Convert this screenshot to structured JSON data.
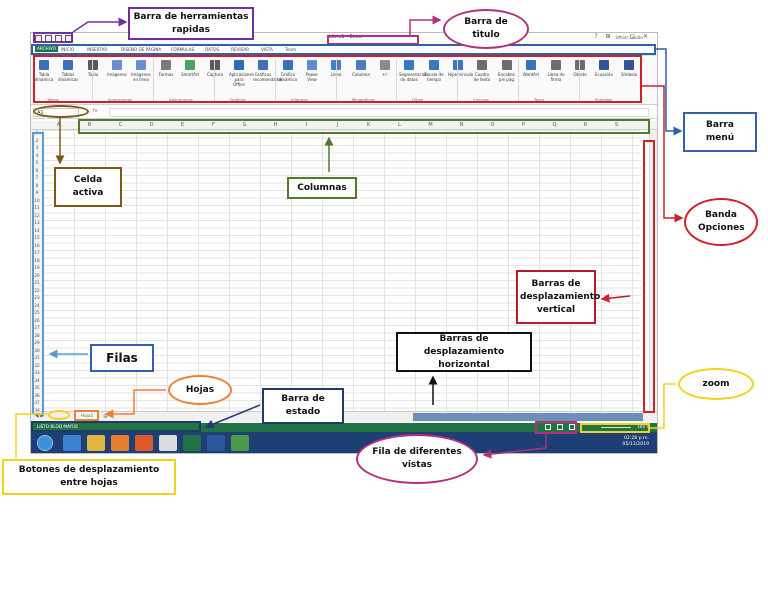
{
  "excel": {
    "title": "Libro1 - Excel",
    "window_controls": "? ⊞ – ▢ ✕",
    "tabs": [
      "ARCHIVO",
      "INICIO",
      "INSERTAR",
      "DISEÑO DE PÁGINA",
      "FÓRMULAS",
      "DATOS",
      "REVISAR",
      "VISTA",
      "Team"
    ],
    "sign_in": "Iniciar sesión",
    "ribbon_items": [
      {
        "label": "Tabla dinámica",
        "color": "#3f6fb6"
      },
      {
        "label": "Tablas dinámicas",
        "color": "#3f6fb6"
      },
      {
        "label": "Tabla",
        "color": "#5a5a5a"
      },
      {
        "label": "Imágenes",
        "color": "#6a8fcf"
      },
      {
        "label": "Imágenes en línea",
        "color": "#6a8fcf"
      },
      {
        "label": "Formas",
        "color": "#7b7b7b"
      },
      {
        "label": "SmartArt",
        "color": "#49a35b"
      },
      {
        "label": "Captura",
        "color": "#5a5a5a"
      },
      {
        "label": "Aplicaciones para Office",
        "color": "#2e6db4"
      },
      {
        "label": "Gráficos recomendados",
        "color": "#3f6fb6"
      },
      {
        "label": "Gráfico dinámico",
        "color": "#3f6fb6"
      },
      {
        "label": "Power View",
        "color": "#5b8fd3"
      },
      {
        "label": "Línea",
        "color": "#4a7cc0"
      },
      {
        "label": "Columna",
        "color": "#4a7cc0"
      },
      {
        "label": "+/-",
        "color": "#8a8a8a"
      },
      {
        "label": "Segmentación de datos",
        "color": "#3a78c2"
      },
      {
        "label": "Escala de tiempo",
        "color": "#3a78c2"
      },
      {
        "label": "Hipervínculo",
        "color": "#3a78c2"
      },
      {
        "label": "Cuadro de texto",
        "color": "#6d6d6d"
      },
      {
        "label": "Encabez. pie pág.",
        "color": "#6d6d6d"
      },
      {
        "label": "WordArt",
        "color": "#3a6fc0"
      },
      {
        "label": "Línea de firma",
        "color": "#6d6d6d"
      },
      {
        "label": "Objeto",
        "color": "#6d6d6d"
      },
      {
        "label": "Ecuación",
        "color": "#2f5597"
      },
      {
        "label": "Símbolo",
        "color": "#2f5597"
      }
    ],
    "ribbon_groups": [
      "Tablas",
      "Ilustraciones",
      "Aplicaciones",
      "Gráficos",
      "Informes",
      "Minigráficos",
      "Filtros",
      "Vínculos",
      "Texto",
      "Símbolos"
    ],
    "name_box": "A1",
    "fx_label": "fx",
    "columns": [
      "A",
      "B",
      "C",
      "D",
      "E",
      "F",
      "G",
      "H",
      "I",
      "J",
      "K",
      "L",
      "M",
      "N",
      "O",
      "P",
      "Q",
      "R",
      "S"
    ],
    "rows": [
      "1",
      "2",
      "3",
      "4",
      "5",
      "6",
      "7",
      "8",
      "9",
      "10",
      "11",
      "12",
      "13",
      "14",
      "15",
      "16",
      "17",
      "18",
      "19",
      "20",
      "21",
      "22",
      "23",
      "24",
      "25",
      "26",
      "27",
      "28",
      "29",
      "30",
      "31",
      "32",
      "33",
      "34",
      "35",
      "36",
      "37",
      "38"
    ],
    "sheet_tab": "Hoja1",
    "status_text": "LISTO    BLOQ MAYÚS",
    "zoom_text": "100 %",
    "clock": {
      "time": "02:28 p.m.",
      "date": "05/11/2019"
    },
    "accent": "#217346"
  },
  "annotations": {
    "quick_access": "Barra de herramientas rapidas",
    "title_bar": "Barra de titulo",
    "menu_bar": "Barra menú",
    "ribbon": "Banda Opciones",
    "active_cell": "Celda activa",
    "columns": "Columnas",
    "vertical_scroll": "Barras de desplazamiento vertical",
    "horizontal_scroll": "Barras de desplazamiento horizontal",
    "rows": "Filas",
    "sheets": "Hojas",
    "status_bar": "Barra de estado",
    "zoom": "zoom",
    "views_row": "Fila de diferentes vistas",
    "sheet_scroll_buttons": "Botones de desplazamiento entre hojas"
  },
  "colors": {
    "purple": "#7030a0",
    "magenta": "#b4307f",
    "red": "#d0202a",
    "dark_red": "#b01e28",
    "green": "#507a2c",
    "blue": "#2f62a8",
    "dark_blue": "#1f3a6b",
    "orange": "#ef7f35",
    "yellow": "#f2d21c",
    "brown": "#7a5a14",
    "black": "#111111"
  }
}
